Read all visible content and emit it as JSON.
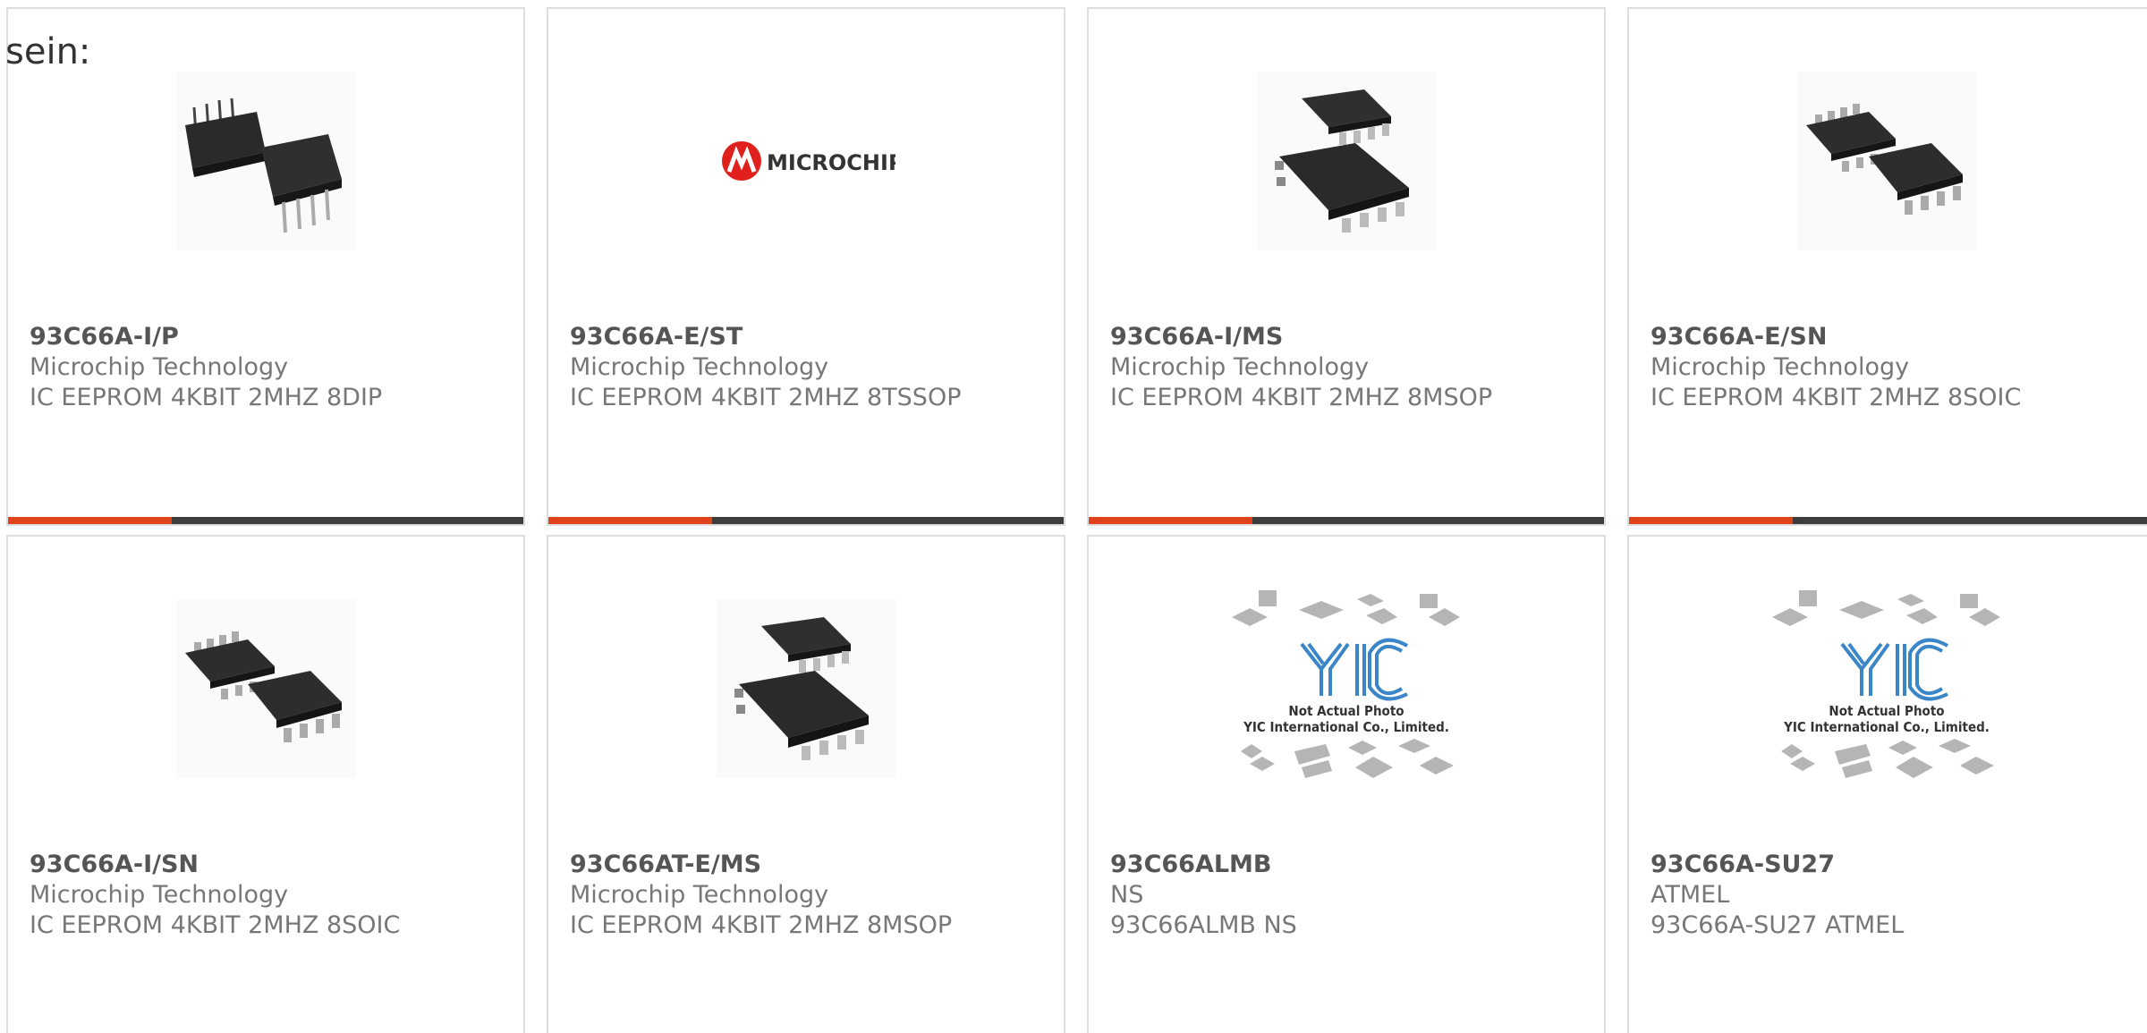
{
  "heading": "sein:",
  "colors": {
    "accent": "#e0431c",
    "bar": "#3d3d3d",
    "border": "#dedede"
  },
  "products": [
    {
      "part_number": "93C66A-I/P",
      "manufacturer": "Microchip Technology",
      "description": "IC EEPROM 4KBIT 2MHZ 8DIP",
      "image": "dip8-chip-photo"
    },
    {
      "part_number": "93C66A-E/ST",
      "manufacturer": "Microchip Technology",
      "description": "IC EEPROM 4KBIT 2MHZ 8TSSOP",
      "image": "microchip-logo",
      "logo_text": "MICROCHIP"
    },
    {
      "part_number": "93C66A-I/MS",
      "manufacturer": "Microchip Technology",
      "description": "IC EEPROM 4KBIT 2MHZ 8MSOP",
      "image": "msop8-chip-photo"
    },
    {
      "part_number": "93C66A-E/SN",
      "manufacturer": "Microchip Technology",
      "description": "IC EEPROM 4KBIT 2MHZ 8SOIC",
      "image": "soic8-chip-photo"
    },
    {
      "part_number": "93C66A-I/SN",
      "manufacturer": "Microchip Technology",
      "description": "IC EEPROM 4KBIT 2MHZ 8SOIC",
      "image": "soic8-chip-photo"
    },
    {
      "part_number": "93C66AT-E/MS",
      "manufacturer": "Microchip Technology",
      "description": "IC EEPROM 4KBIT 2MHZ 8MSOP",
      "image": "msop8-chip-photo"
    },
    {
      "part_number": "93C66ALMB",
      "manufacturer": "NS",
      "description": "93C66ALMB NS",
      "image": "placeholder-photo",
      "placeholder_lines": [
        "Not Actual Photo",
        "YIC International Co., Limited."
      ]
    },
    {
      "part_number": "93C66A-SU27",
      "manufacturer": "ATMEL",
      "description": "93C66A-SU27 ATMEL",
      "image": "placeholder-photo",
      "placeholder_lines": [
        "Not Actual Photo",
        "YIC International Co., Limited."
      ]
    }
  ]
}
